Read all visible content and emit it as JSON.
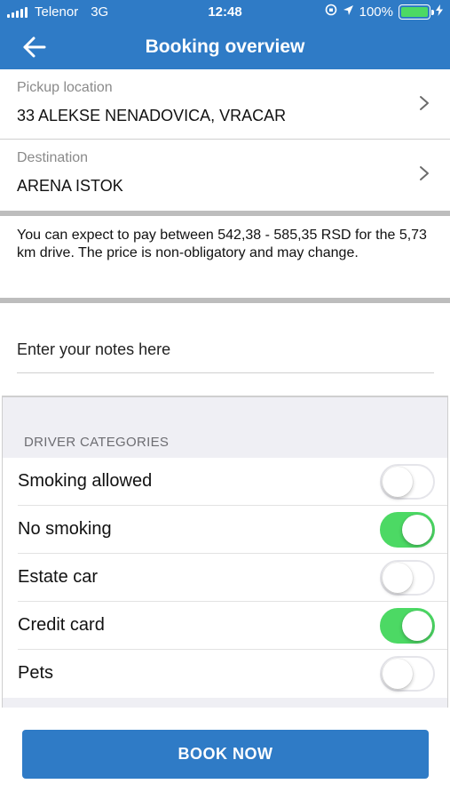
{
  "status_bar": {
    "carrier": "Telenor",
    "network": "3G",
    "time": "12:48",
    "battery_percent": "100%",
    "battery_level": 1.0
  },
  "nav": {
    "title": "Booking overview",
    "back_icon": "arrow-left-icon"
  },
  "pickup": {
    "label": "Pickup location",
    "value": "33 ALEKSE NENADOVICA, VRACAR"
  },
  "destination": {
    "label": "Destination",
    "value": "ARENA ISTOK"
  },
  "price_info": "You can expect to pay between 542,38 - 585,35 RSD for the 5,73 km drive. The price is non-obligatory and may change.",
  "notes": {
    "placeholder": "Enter your notes here",
    "value": ""
  },
  "driver_categories": {
    "header": "DRIVER CATEGORIES",
    "items": [
      {
        "label": "Smoking allowed",
        "on": false
      },
      {
        "label": "No smoking",
        "on": true
      },
      {
        "label": "Estate car",
        "on": false
      },
      {
        "label": "Credit card",
        "on": true
      },
      {
        "label": "Pets",
        "on": false
      }
    ]
  },
  "book_button": "BOOK NOW",
  "colors": {
    "primary": "#2f7bc6",
    "toggle_on": "#4cd964",
    "group_bg": "#efeff4"
  }
}
